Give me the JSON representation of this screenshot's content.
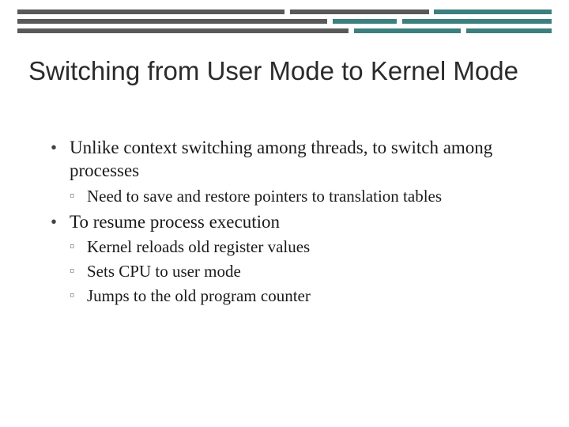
{
  "slide": {
    "title": "Switching from User Mode to Kernel Mode",
    "bullets": {
      "b1": "Unlike context switching among threads, to switch among processes",
      "b1_1": "Need to save and restore pointers to translation tables",
      "b2": "To resume process execution",
      "b2_1": "Kernel reloads old register values",
      "b2_2": "Sets CPU to user mode",
      "b2_3": "Jumps to the old program counter"
    }
  },
  "theme": {
    "accent_gray": "#595959",
    "accent_teal": "#3c7f7f"
  }
}
